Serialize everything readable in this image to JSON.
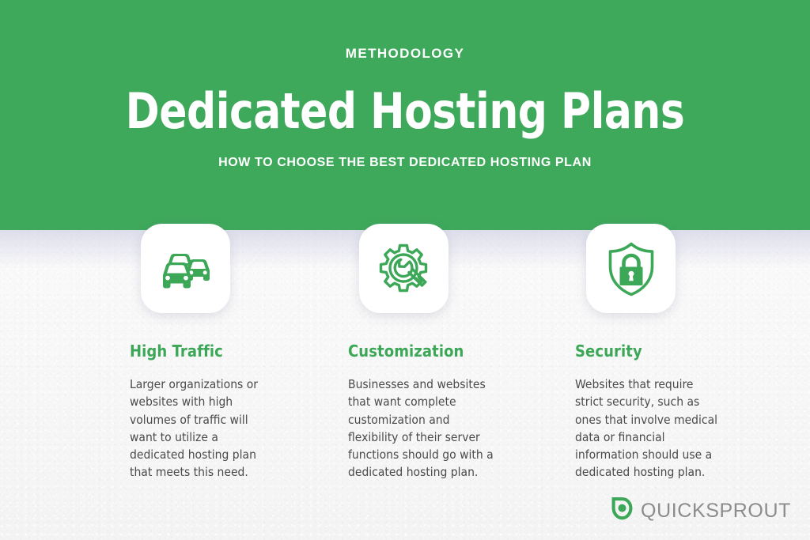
{
  "header": {
    "eyebrow": "METHODOLOGY",
    "title": "Dedicated Hosting Plans",
    "subtitle": "HOW TO CHOOSE THE BEST DEDICATED HOSTING PLAN",
    "background_color": "#3ea95b",
    "text_color": "#ffffff"
  },
  "theme": {
    "accent_green": "#3ba757",
    "body_text": "#4a4a4a",
    "page_background": "#f7f7f6"
  },
  "columns": [
    {
      "icon": "traffic-cars-icon",
      "title": "High Traffic",
      "body": "Larger organizations or websites with high volumes of traffic will want to utilize a dedicated hosting plan that meets this need."
    },
    {
      "icon": "gear-wrench-icon",
      "title": "Customization",
      "body": "Businesses and websites that want complete customization and flexibility of their server functions should go with a dedicated hosting plan."
    },
    {
      "icon": "shield-lock-icon",
      "title": "Security",
      "body": "Websites that require strict security, such as ones that involve medical data or financial information should use a dedicated hosting plan."
    }
  ],
  "logo": {
    "mark": "quicksprout-sprout-icon",
    "text": "QUICKSPROUT",
    "mark_color": "#3ba757",
    "text_color": "#8c8c8c"
  }
}
